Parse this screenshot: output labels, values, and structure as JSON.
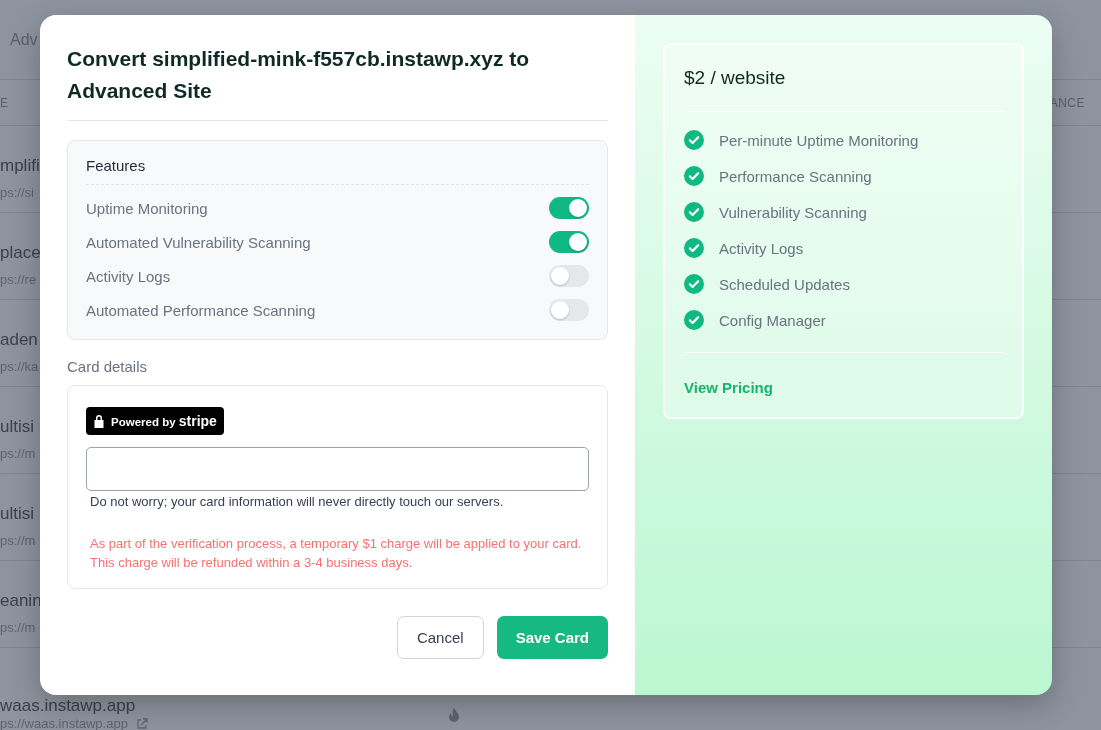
{
  "background": {
    "tab": "Adv",
    "columns": [
      "E",
      "ANCE"
    ],
    "rows": [
      {
        "name": "mplifi",
        "url": "ps://si"
      },
      {
        "name": "place",
        "url": "ps://re"
      },
      {
        "name": "aden",
        "url": "ps://ka"
      },
      {
        "name": "ultisi",
        "url": "ps://m"
      },
      {
        "name": "ultisi",
        "url": "ps://m"
      },
      {
        "name": "eanin",
        "url": "ps://m"
      },
      {
        "name": "waas.instawp.app",
        "url": "ps://waas.instawp.app"
      }
    ]
  },
  "modal": {
    "title": "Convert simplified-mink-f557cb.instawp.xyz to Advanced Site",
    "features": {
      "heading": "Features",
      "items": [
        {
          "label": "Uptime Monitoring",
          "on": true
        },
        {
          "label": "Automated Vulnerability Scanning",
          "on": true
        },
        {
          "label": "Activity Logs",
          "on": false
        },
        {
          "label": "Automated Performance Scanning",
          "on": false
        }
      ]
    },
    "card_details": {
      "label": "Card details",
      "badge_prefix": "Powered by",
      "badge_brand": "stripe",
      "note": "Do not worry; your card information will never directly touch our servers.",
      "warning": "As part of the verification process, a temporary $1 charge will be applied to your card. This charge will be refunded within a 3-4 business days."
    },
    "buttons": [
      {
        "label": "Cancel",
        "kind": "secondary"
      },
      {
        "label": "Save Card",
        "kind": "primary"
      }
    ]
  },
  "plan": {
    "price": "$2 / website",
    "features": [
      "Per-minute Uptime Monitoring",
      "Performance Scanning",
      "Vulnerability Scanning",
      "Activity Logs",
      "Scheduled Updates",
      "Config Manager"
    ],
    "link": "View Pricing"
  }
}
